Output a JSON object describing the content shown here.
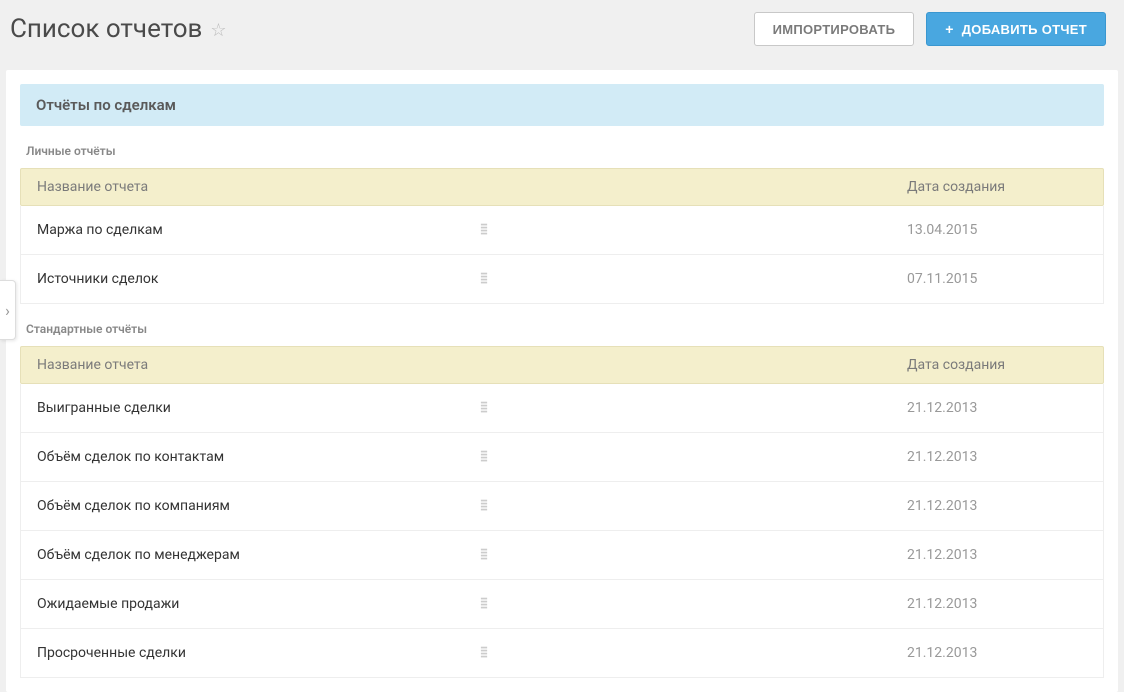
{
  "header": {
    "title": "Список отчетов",
    "import_button": "ИМПОРТИРОВАТЬ",
    "add_button": "ДОБАВИТЬ ОТЧЕТ"
  },
  "section": {
    "title": "Отчёты по сделкам"
  },
  "columns": {
    "name": "Название отчета",
    "date": "Дата создания"
  },
  "groups": [
    {
      "label": "Личные отчёты",
      "rows": [
        {
          "name": "Маржа по сделкам",
          "date": "13.04.2015"
        },
        {
          "name": "Источники сделок",
          "date": "07.11.2015"
        }
      ]
    },
    {
      "label": "Стандартные отчёты",
      "rows": [
        {
          "name": "Выигранные сделки",
          "date": "21.12.2013"
        },
        {
          "name": "Объём сделок по контактам",
          "date": "21.12.2013"
        },
        {
          "name": "Объём сделок по компаниям",
          "date": "21.12.2013"
        },
        {
          "name": "Объём сделок по менеджерам",
          "date": "21.12.2013"
        },
        {
          "name": "Ожидаемые продажи",
          "date": "21.12.2013"
        },
        {
          "name": "Просроченные сделки",
          "date": "21.12.2013"
        }
      ]
    }
  ]
}
